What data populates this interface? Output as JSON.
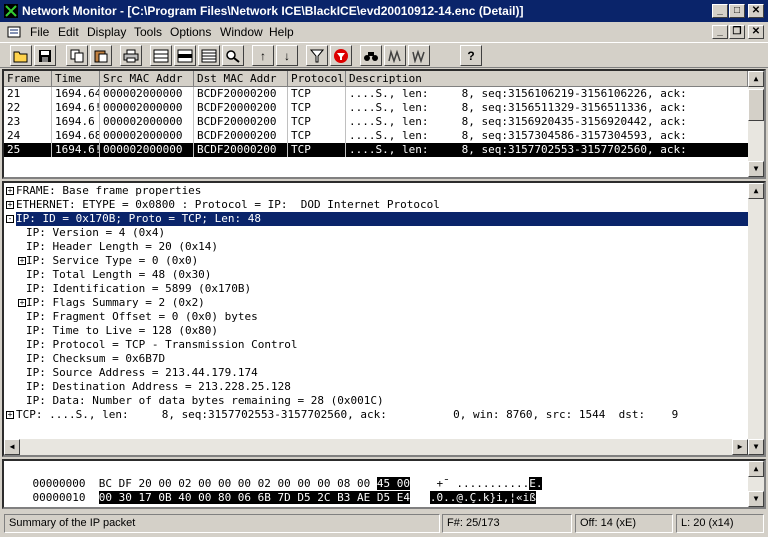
{
  "window": {
    "title": "Network Monitor - [C:\\Program Files\\Network ICE\\BlackICE\\evd20010912-14.enc (Detail)]",
    "minimize": "_",
    "maximize": "□",
    "close": "✕"
  },
  "menu": {
    "items": [
      "File",
      "Edit",
      "Display",
      "Tools",
      "Options",
      "Window",
      "Help"
    ],
    "mdi_min": "_",
    "mdi_restore": "❐",
    "mdi_close": "✕"
  },
  "toolbar": {
    "buttons": [
      "open-icon",
      "save-icon",
      "copy-icon",
      "paste-icon",
      "print-icon",
      "view-split-icon",
      "view-detail-icon",
      "view-hex-icon",
      "zoom-icon",
      "up-arrow-icon",
      "down-arrow-icon",
      "filter-icon",
      "stop-filter-icon",
      "find-icon",
      "find-prev-icon",
      "find-next-icon",
      "help-icon"
    ],
    "up_glyph": "↑",
    "down_glyph": "↓",
    "help_glyph": "?"
  },
  "packet_list": {
    "columns": [
      "Frame",
      "Time",
      "Src MAC Addr",
      "Dst MAC Addr",
      "Protocol",
      "Description"
    ],
    "rows": [
      {
        "frame": "21",
        "time": "1694.64",
        "src": "000002000000",
        "dst": "BCDF20000200",
        "proto": "TCP",
        "desc": "....S., len:     8, seq:3156106219-3156106226, ack:"
      },
      {
        "frame": "22",
        "time": "1694.6!",
        "src": "000002000000",
        "dst": "BCDF20000200",
        "proto": "TCP",
        "desc": "....S., len:     8, seq:3156511329-3156511336, ack:"
      },
      {
        "frame": "23",
        "time": "1694.6",
        "src": "000002000000",
        "dst": "BCDF20000200",
        "proto": "TCP",
        "desc": "....S., len:     8, seq:3156920435-3156920442, ack:"
      },
      {
        "frame": "24",
        "time": "1694.68",
        "src": "000002000000",
        "dst": "BCDF20000200",
        "proto": "TCP",
        "desc": "....S., len:     8, seq:3157304586-3157304593, ack:"
      },
      {
        "frame": "25",
        "time": "1694.6!",
        "src": "000002000000",
        "dst": "BCDF20000200",
        "proto": "TCP",
        "desc": "....S., len:     8, seq:3157702553-3157702560, ack:"
      }
    ],
    "selected_index": 4
  },
  "detail": {
    "lines": [
      {
        "text": "FRAME: Base frame properties",
        "expander": "+",
        "indent": 0
      },
      {
        "text": "ETHERNET: ETYPE = 0x0800 : Protocol = IP:  DOD Internet Protocol",
        "expander": "+",
        "indent": 0
      },
      {
        "text": "IP: ID = 0x170B; Proto = TCP; Len: 48",
        "expander": "-",
        "indent": 0,
        "selected": true
      },
      {
        "text": "IP: Version = 4 (0x4)",
        "expander": "",
        "indent": 1
      },
      {
        "text": "IP: Header Length = 20 (0x14)",
        "expander": "",
        "indent": 1
      },
      {
        "text": "IP: Service Type = 0 (0x0)",
        "expander": "+",
        "indent": 1
      },
      {
        "text": "IP: Total Length = 48 (0x30)",
        "expander": "",
        "indent": 1
      },
      {
        "text": "IP: Identification = 5899 (0x170B)",
        "expander": "",
        "indent": 1
      },
      {
        "text": "IP: Flags Summary = 2 (0x2)",
        "expander": "+",
        "indent": 1
      },
      {
        "text": "IP: Fragment Offset = 0 (0x0) bytes",
        "expander": "",
        "indent": 1
      },
      {
        "text": "IP: Time to Live = 128 (0x80)",
        "expander": "",
        "indent": 1
      },
      {
        "text": "IP: Protocol = TCP - Transmission Control",
        "expander": "",
        "indent": 1
      },
      {
        "text": "IP: Checksum = 0x6B7D",
        "expander": "",
        "indent": 1
      },
      {
        "text": "IP: Source Address = 213.44.179.174",
        "expander": "",
        "indent": 1
      },
      {
        "text": "IP: Destination Address = 213.228.25.128",
        "expander": "",
        "indent": 1
      },
      {
        "text": "IP: Data: Number of data bytes remaining = 28 (0x001C)",
        "expander": "",
        "indent": 1
      },
      {
        "text": "TCP: ....S., len:     8, seq:3157702553-3157702560, ack:          0, win: 8760, src: 1544  dst:    9",
        "expander": "+",
        "indent": 0
      }
    ]
  },
  "hex": {
    "lines": [
      {
        "offset": "00000000",
        "pre": "BC DF 20 00 02 00 00 00 02 00 00 00 08 00 ",
        "hl": "45 00",
        "post": "",
        "ascii_pre": "+¯ ...........",
        "ascii_hl": "E."
      },
      {
        "offset": "00000010",
        "pre": "",
        "hl": "00 30 17 0B 40 00 80 06 6B 7D D5 2C B3 AE D5 E4",
        "post": "",
        "ascii_pre": "",
        "ascii_hl": ".0..@.Ç.k}i,¦«iß"
      }
    ]
  },
  "status": {
    "message": "Summary of the IP packet",
    "frame": "F#: 25/173",
    "offset": "Off: 14 (xE)",
    "length": "L: 20 (x14)"
  },
  "colors": {
    "titlebar": "#0a246a",
    "selection": "#0a246a",
    "row_selection": "#000000"
  }
}
